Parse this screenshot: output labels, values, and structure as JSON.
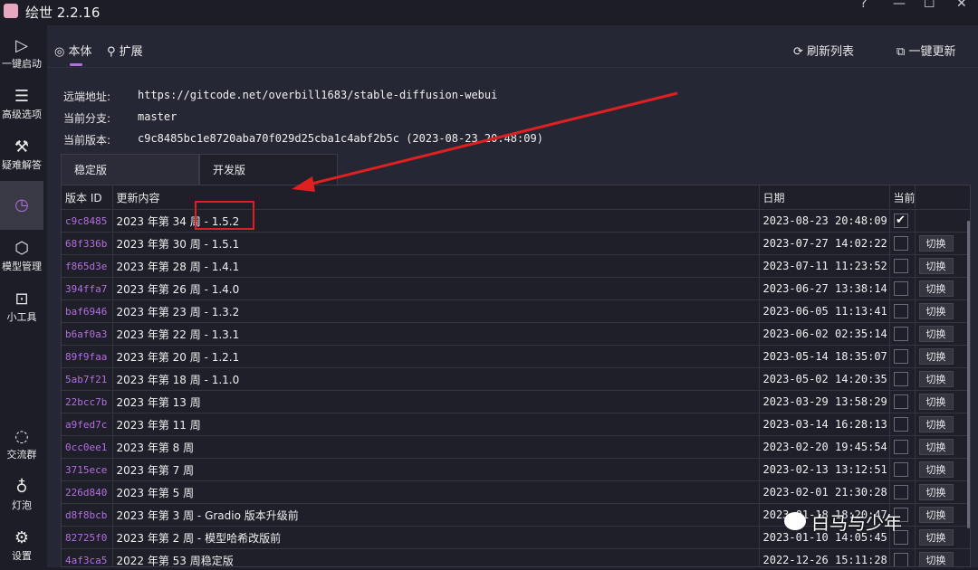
{
  "app": {
    "title": "绘世 2.2.16"
  },
  "window_controls": [
    "?",
    "—",
    "☐",
    "✕"
  ],
  "sidebar": {
    "items": [
      {
        "label": "一键启动",
        "icon": "play-icon"
      },
      {
        "label": "高级选项",
        "icon": "list-settings-icon"
      },
      {
        "label": "疑难解答",
        "icon": "tools-icon"
      },
      {
        "label": "",
        "icon": "history-icon"
      },
      {
        "label": "模型管理",
        "icon": "cube-icon"
      },
      {
        "label": "小工具",
        "icon": "toolbox-icon"
      },
      {
        "label": "交流群",
        "icon": "chat-icon"
      },
      {
        "label": "灯泡",
        "icon": "bulb-icon"
      },
      {
        "label": "设置",
        "icon": "gear-icon"
      }
    ]
  },
  "tabs": {
    "body": "本体",
    "ext": "扩展"
  },
  "actions": {
    "refresh": "刷新列表",
    "update": "一键更新"
  },
  "info": {
    "remote_label": "远端地址:",
    "remote_value": "https://gitcode.net/overbill1683/stable-diffusion-webui",
    "branch_label": "当前分支:",
    "branch_value": "master",
    "version_label": "当前版本:",
    "version_value": "c9c8485bc1e8720aba70f029d25cba1c4abf2b5c (2023-08-23 20:48:09)"
  },
  "subtabs": {
    "stable": "稳定版",
    "dev": "开发版"
  },
  "table": {
    "headers": {
      "id": "版本 ID",
      "desc": "更新内容",
      "date": "日期",
      "current": "当前"
    },
    "switch_label": "切换",
    "rows": [
      {
        "id": "c9c8485",
        "desc": "2023 年第 34 周 - 1.5.2",
        "date": "2023-08-23 20:48:09",
        "current": true
      },
      {
        "id": "68f336b",
        "desc": "2023 年第 30 周 - 1.5.1",
        "date": "2023-07-27 14:02:22",
        "current": false
      },
      {
        "id": "f865d3e",
        "desc": "2023 年第 28 周 - 1.4.1",
        "date": "2023-07-11 11:23:52",
        "current": false
      },
      {
        "id": "394ffa7",
        "desc": "2023 年第 26 周 - 1.4.0",
        "date": "2023-06-27 13:38:14",
        "current": false
      },
      {
        "id": "baf6946",
        "desc": "2023 年第 23 周 - 1.3.2",
        "date": "2023-06-05 11:13:41",
        "current": false
      },
      {
        "id": "b6af0a3",
        "desc": "2023 年第 22 周 - 1.3.1",
        "date": "2023-06-02 02:35:14",
        "current": false
      },
      {
        "id": "89f9faa",
        "desc": "2023 年第 20 周 - 1.2.1",
        "date": "2023-05-14 18:35:07",
        "current": false
      },
      {
        "id": "5ab7f21",
        "desc": "2023 年第 18 周 - 1.1.0",
        "date": "2023-05-02 14:20:35",
        "current": false
      },
      {
        "id": "22bcc7b",
        "desc": "2023 年第 13 周",
        "date": "2023-03-29 13:58:29",
        "current": false
      },
      {
        "id": "a9fed7c",
        "desc": "2023 年第 11 周",
        "date": "2023-03-14 16:28:13",
        "current": false
      },
      {
        "id": "0cc0ee1",
        "desc": "2023 年第 8 周",
        "date": "2023-02-20 19:45:54",
        "current": false
      },
      {
        "id": "3715ece",
        "desc": "2023 年第 7 周",
        "date": "2023-02-13 13:12:51",
        "current": false
      },
      {
        "id": "226d840",
        "desc": "2023 年第 5 周",
        "date": "2023-02-01 21:30:28",
        "current": false
      },
      {
        "id": "d8f8bcb",
        "desc": "2023 年第 3 周 - Gradio 版本升级前",
        "date": "2023-01-18 18:20:47",
        "current": false
      },
      {
        "id": "82725f0",
        "desc": "2023 年第 2 周 - 模型哈希改版前",
        "date": "2023-01-10 14:05:45",
        "current": false
      },
      {
        "id": "4af3ca5",
        "desc": "2022 年第 53 周稳定版",
        "date": "2022-12-26 15:11:28",
        "current": false
      }
    ]
  },
  "watermark": "白马与少年",
  "colors": {
    "accent": "#b46ee0",
    "annotation": "#e02020"
  }
}
